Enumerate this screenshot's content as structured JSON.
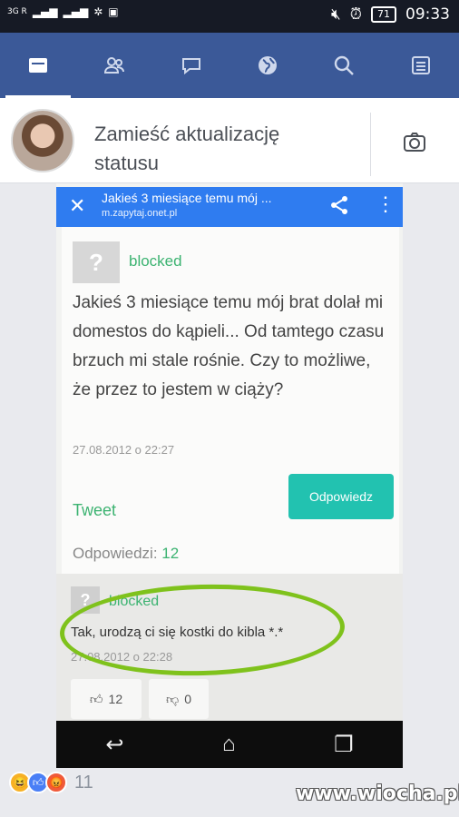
{
  "status_bar": {
    "network": "3G R",
    "time": "09:33",
    "battery": "71"
  },
  "fb_nav": {
    "tabs": [
      {
        "icon": "news-feed-icon",
        "active": true
      },
      {
        "icon": "friends-icon",
        "active": false
      },
      {
        "icon": "messenger-icon",
        "active": false
      },
      {
        "icon": "globe-icon",
        "active": false
      },
      {
        "icon": "search-icon",
        "active": false
      },
      {
        "icon": "menu-icon",
        "active": false
      }
    ]
  },
  "composer": {
    "prompt": "Zamieść aktualizację statusu",
    "camera_icon": "camera-icon"
  },
  "shared_screenshot": {
    "browser": {
      "title": "Jakieś 3 miesiące temu mój ...",
      "url": "m.zapytaj.onet.pl"
    },
    "question": {
      "user": "blocked",
      "text": "Jakieś 3 miesiące temu mój brat dolał mi domestos do kąpieli... Od tamtego czasu brzuch mi stale rośnie. Czy to możliwe, że przez to jestem w ciąży?",
      "date": "27.08.2012 o 22:27",
      "answer_button": "Odpowiedz",
      "tweet": "Tweet",
      "answers_label": "Odpowiedzi:",
      "answers_count": "12"
    },
    "answer": {
      "user": "blocked",
      "text": "Tak, urodzą ci się kostki do kibla *.*",
      "date": "27.08.2012 o 22:28",
      "likes": "12",
      "dislikes": "0"
    }
  },
  "reactions": {
    "count": "11"
  },
  "watermark": "www.wiocha.pl",
  "colors": {
    "fb_blue": "#3b5998",
    "browser_blue": "#2f7cf0",
    "green_text": "#3cb371",
    "teal_button": "#22c2b0",
    "highlight": "#7fc21c"
  }
}
